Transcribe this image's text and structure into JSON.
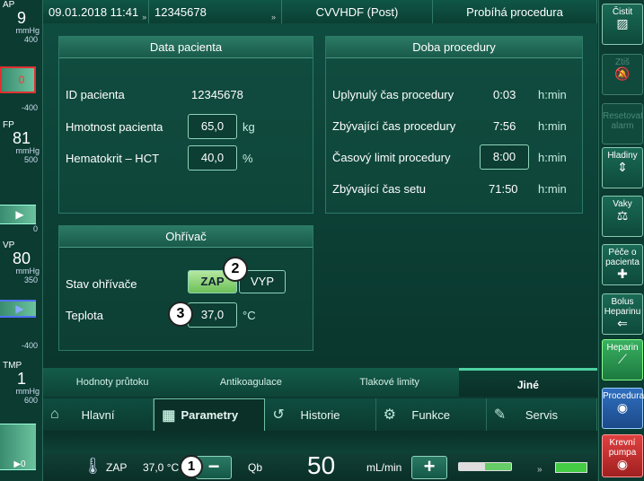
{
  "topbar": {
    "datetime": "09.01.2018 11:41",
    "patient_id": "12345678",
    "therapy": "CVVHDF (Post)",
    "status": "Probíhá procedura",
    "arrow": "»"
  },
  "gauges": [
    {
      "name": "AP",
      "value": "9",
      "unit": "mmHg",
      "top": "400",
      "mid": "0",
      "bottom": "-400",
      "marker": "0"
    },
    {
      "name": "FP",
      "value": "81",
      "unit": "mmHg",
      "top": "500",
      "mid": "0",
      "bottom": "",
      "marker": "▶"
    },
    {
      "name": "VP",
      "value": "80",
      "unit": "mmHg",
      "top": "350",
      "mid": "",
      "bottom": "-400",
      "marker": "▶"
    },
    {
      "name": "TMP",
      "value": "1",
      "unit": "mmHg",
      "top": "600",
      "mid": "",
      "bottom": "",
      "marker": "▶0"
    }
  ],
  "patient_panel": {
    "title": "Data pacienta",
    "id_label": "ID pacienta",
    "id_value": "12345678",
    "weight_label": "Hmotnost pacienta",
    "weight_value": "65,0",
    "weight_unit": "kg",
    "hct_label": "Hematokrit – HCT",
    "hct_value": "40,0",
    "hct_unit": "%"
  },
  "time_panel": {
    "title": "Doba procedury",
    "rows": [
      {
        "label": "Uplynulý čas procedury",
        "value": "0:03",
        "unit": "h:min"
      },
      {
        "label": "Zbývající čas procedury",
        "value": "7:56",
        "unit": "h:min"
      },
      {
        "label": "Časový limit procedury",
        "value": "8:00",
        "unit": "h:min"
      },
      {
        "label": "Zbývající čas setu",
        "value": "71:50",
        "unit": "h:min"
      }
    ]
  },
  "heater_panel": {
    "title": "Ohřívač",
    "state_label": "Stav ohřívače",
    "on": "ZAP",
    "off": "VYP",
    "temp_label": "Teplota",
    "temp_value": "37,0",
    "temp_unit": "°C"
  },
  "callouts": [
    "1",
    "2",
    "3"
  ],
  "subtabs": [
    "Hodnoty průtoku",
    "Antikoagulace",
    "Tlakové limity",
    "Jiné"
  ],
  "maintabs": [
    {
      "label": "Hlavní",
      "icon": "home-icon"
    },
    {
      "label": "Parametry",
      "icon": "calculator-icon"
    },
    {
      "label": "Historie",
      "icon": "history-icon"
    },
    {
      "label": "Funkce",
      "icon": "gear-icon"
    },
    {
      "label": "Servis",
      "icon": "wrench-icon"
    }
  ],
  "bottom": {
    "heater_state": "ZAP",
    "temp": "37,0 °C",
    "minus": "−",
    "qb_label": "Qb",
    "qb_value": "50",
    "qb_unit": "mL/min",
    "plus": "+"
  },
  "right_buttons": [
    {
      "label": "Čistit",
      "icon": "clean-icon",
      "enabled": true
    },
    {
      "label": "Ztiš",
      "icon": "mute-icon",
      "enabled": false
    },
    {
      "label": "Resetovat alarm",
      "icon": "",
      "enabled": false
    },
    {
      "label": "Hladiny",
      "icon": "level-icon",
      "enabled": true
    },
    {
      "label": "Vaky",
      "icon": "bag-icon",
      "enabled": true
    },
    {
      "label": "Péče o pacienta",
      "icon": "patient-care-icon",
      "enabled": true
    },
    {
      "label": "Bolus Heparinu",
      "icon": "bolus-icon",
      "enabled": true
    },
    {
      "label": "Heparin",
      "icon": "syringe-icon",
      "enabled": true
    },
    {
      "label": "Procedura",
      "icon": "procedure-icon",
      "enabled": true
    },
    {
      "label": "Krevní pumpa",
      "icon": "pump-icon",
      "enabled": true
    }
  ]
}
